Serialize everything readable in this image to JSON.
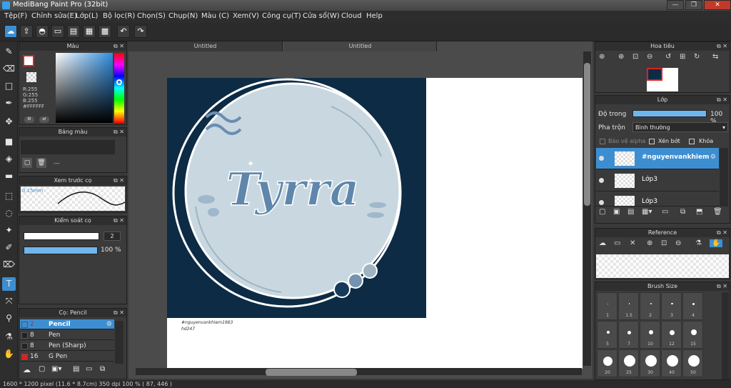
{
  "window": {
    "title": "MediBang Paint Pro (32bit)"
  },
  "menu": [
    "Tệp(F)",
    "Chỉnh sửa(E)",
    "Lớp(L)",
    "Bộ lọc(R)",
    "Chọn(S)",
    "Chụp(N)",
    "Màu (C)",
    "Xem(V)",
    "Công cụ(T)",
    "Cửa sổ(W)",
    "Cloud",
    "Help"
  ],
  "tabs": [
    "Untitled",
    "Untitled"
  ],
  "color_panel": {
    "title": "Màu",
    "r": "R:255",
    "g": "G:255",
    "b": "B:255",
    "hex": "#FFFFFF",
    "fg_color": "#ffffff",
    "accent": "#e02020"
  },
  "palette_panel": {
    "title": "Bảng màu",
    "value": "---"
  },
  "brush_preview": {
    "title": "Xem trước cọ",
    "size": "0.15mm"
  },
  "brush_control": {
    "title": "Kiểm soát cọ",
    "size": "2",
    "opacity": "100 %"
  },
  "brush_panel": {
    "title": "Cọ: Pencil",
    "items": [
      {
        "num": "2",
        "name": "Pencil",
        "selected": true
      },
      {
        "num": "8",
        "name": "Pen"
      },
      {
        "num": "8",
        "name": "Pen (Sharp)"
      },
      {
        "num": "16",
        "name": "G Pen"
      }
    ]
  },
  "navigator": {
    "title": "Hoa tiêu"
  },
  "layer_panel": {
    "title": "Lớp",
    "opacity_label": "Độ trong",
    "opacity_value": "100 %",
    "blend_label": "Pha trộn",
    "blend_value": "Bình thường",
    "protect_alpha": "Bảo vệ alpha",
    "clipping": "Xén bớt",
    "lock": "Khóa",
    "layers": [
      "#nguyenvankhiem",
      "Lớp3",
      "Lớp3"
    ]
  },
  "reference": {
    "title": "Reference"
  },
  "brush_size": {
    "title": "Brush Size",
    "sizes": [
      "1",
      "1.5",
      "2",
      "3",
      "4",
      "5",
      "7",
      "10",
      "12",
      "15",
      "20",
      "25",
      "30",
      "40",
      "50"
    ]
  },
  "artwork": {
    "text": "Tyrra",
    "caption1": "#nguyenvankhiem1983",
    "caption2": "hd247"
  },
  "status": {
    "text": "1600 * 1200 pixel   (11.6 * 8.7cm)   350 dpi   100 %   ( 87, 446 )"
  }
}
